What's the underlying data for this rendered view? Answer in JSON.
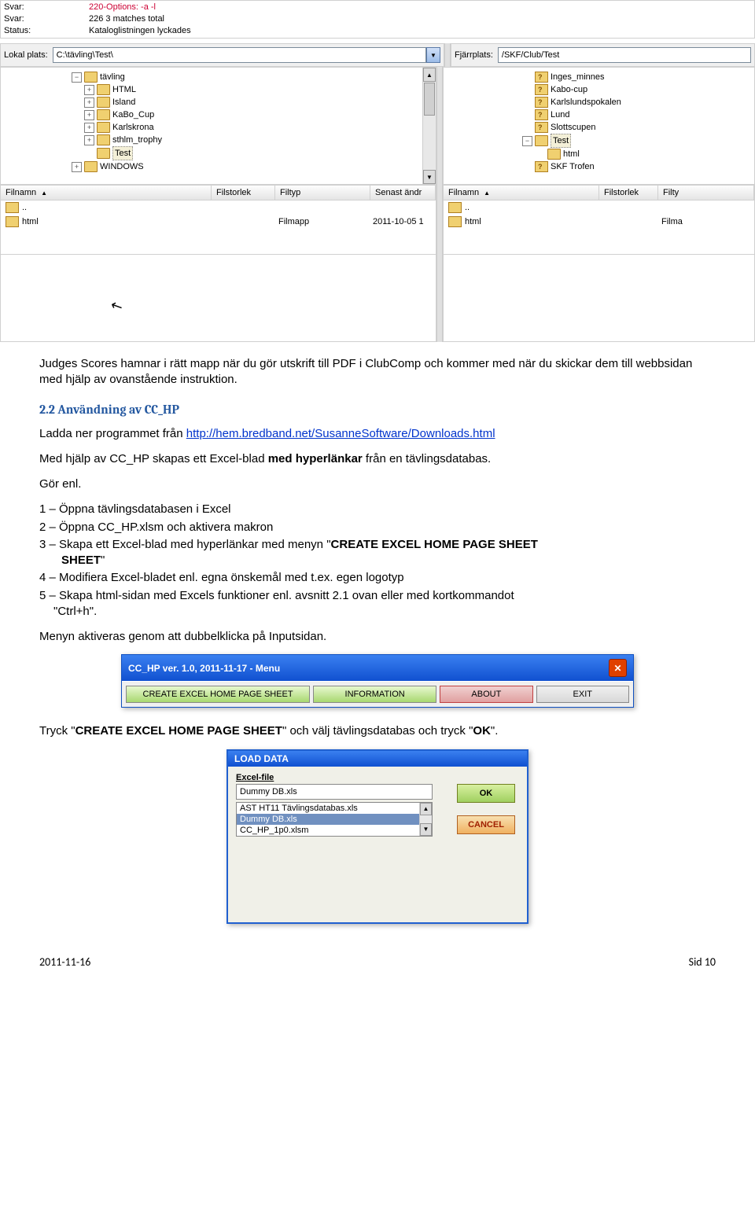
{
  "ftp": {
    "status_labels": "Svar:\nSvar:\nStatus:",
    "status_lines": [
      "220-Options: -a -l",
      "226 3 matches total",
      "Kataloglistningen lyckades"
    ],
    "local_label": "Lokal plats:",
    "local_path": "C:\\tävling\\Test\\",
    "remote_label": "Fjärrplats:",
    "remote_path": "/SKF/Club/Test",
    "local_tree": [
      {
        "d": 0,
        "exp": "minus",
        "icon": "open",
        "label": "tävling"
      },
      {
        "d": 1,
        "exp": "plus",
        "icon": "closed",
        "label": "HTML"
      },
      {
        "d": 1,
        "exp": "plus",
        "icon": "closed",
        "label": "Island"
      },
      {
        "d": 1,
        "exp": "plus",
        "icon": "closed",
        "label": "KaBo_Cup"
      },
      {
        "d": 1,
        "exp": "plus",
        "icon": "closed",
        "label": "Karlskrona"
      },
      {
        "d": 1,
        "exp": "plus",
        "icon": "closed",
        "label": "sthlm_trophy"
      },
      {
        "d": 1,
        "exp": "",
        "icon": "closed",
        "label": "Test",
        "sel": true
      },
      {
        "d": 0,
        "exp": "plus",
        "icon": "closed",
        "label": "WINDOWS"
      }
    ],
    "remote_tree": [
      {
        "d": 0,
        "exp": "",
        "icon": "q",
        "label": "Inges_minnes"
      },
      {
        "d": 0,
        "exp": "",
        "icon": "q",
        "label": "Kabo-cup"
      },
      {
        "d": 0,
        "exp": "",
        "icon": "q",
        "label": "Karlslundspokalen"
      },
      {
        "d": 0,
        "exp": "",
        "icon": "q",
        "label": "Lund"
      },
      {
        "d": 0,
        "exp": "",
        "icon": "q",
        "label": "Slottscupen"
      },
      {
        "d": 0,
        "exp": "minus",
        "icon": "open",
        "label": "Test",
        "sel": true
      },
      {
        "d": 1,
        "exp": "",
        "icon": "closed",
        "label": "html"
      },
      {
        "d": 0,
        "exp": "",
        "icon": "q",
        "label": "SKF Trofen"
      }
    ],
    "headers": {
      "name": "Filnamn",
      "size": "Filstorlek",
      "type": "Filtyp",
      "date": "Senast ändr",
      "typeR": "Filty"
    },
    "local_rows": [
      {
        "name": "..",
        "size": "",
        "type": "",
        "date": ""
      },
      {
        "name": "html",
        "size": "",
        "type": "Filmapp",
        "date": "2011-10-05 1"
      }
    ],
    "remote_rows": [
      {
        "name": "..",
        "size": "",
        "type": ""
      },
      {
        "name": "html",
        "size": "",
        "type": "Filma"
      }
    ]
  },
  "doc": {
    "p1": "Judges Scores hamnar i rätt mapp när du gör utskrift till PDF i ClubComp och kommer med när du skickar dem till webbsidan med hjälp av ovanstående instruktion.",
    "h1": "2.2 Användning av CC_HP",
    "p2_pre": "Ladda ner programmet från ",
    "p2_link": "http://hem.bredband.net/SusanneSoftware/Downloads.html",
    "p3": "Med hjälp av CC_HP skapas ett Excel-blad med hyperlänkar från en tävlingsdatabas.",
    "p4": "Gör enl.",
    "steps": [
      "1 – Öppna tävlingsdatabasen i Excel",
      "2 – Öppna CC_HP.xlsm och aktivera makron",
      "3 – Skapa ett Excel-blad med hyperlänkar med menyn \"CREATE EXCEL HOME PAGE SHEET\"",
      "4 – Modifiera Excel-bladet enl. egna önskemål med t.ex. egen logotyp",
      "5 – Skapa html-sidan med Excels funktioner enl. avsnitt 2.1 ovan eller med kortkommandot \"Ctrl+h\"."
    ],
    "p5": "Menyn aktiveras genom att dubbelklicka på Inputsidan.",
    "p6": "Tryck \"CREATE EXCEL HOME PAGE SHEET\" och välj tävlingsdatabas och tryck \"OK\".",
    "step3_bold": "CREATE EXCEL HOME PAGE SHEET",
    "bold_hyper": "med hyperlänkar",
    "p6_bold1": "CREATE EXCEL HOME PAGE SHEET",
    "p6_bold2": "OK"
  },
  "menu_dlg": {
    "title": "CC_HP ver. 1.0, 2011-11-17 - Menu",
    "btn_create": "CREATE EXCEL HOME PAGE SHEET",
    "btn_info": "INFORMATION",
    "btn_about": "ABOUT",
    "btn_exit": "EXIT"
  },
  "load_dlg": {
    "title": "LOAD DATA",
    "label": "Excel-file",
    "input": "Dummy DB.xls",
    "options": [
      "AST HT11 Tävlingsdatabas.xls",
      "Dummy DB.xls",
      "CC_HP_1p0.xlsm"
    ],
    "ok": "OK",
    "cancel": "CANCEL"
  },
  "footer": {
    "date": "2011-11-16",
    "page": "Sid 10"
  }
}
